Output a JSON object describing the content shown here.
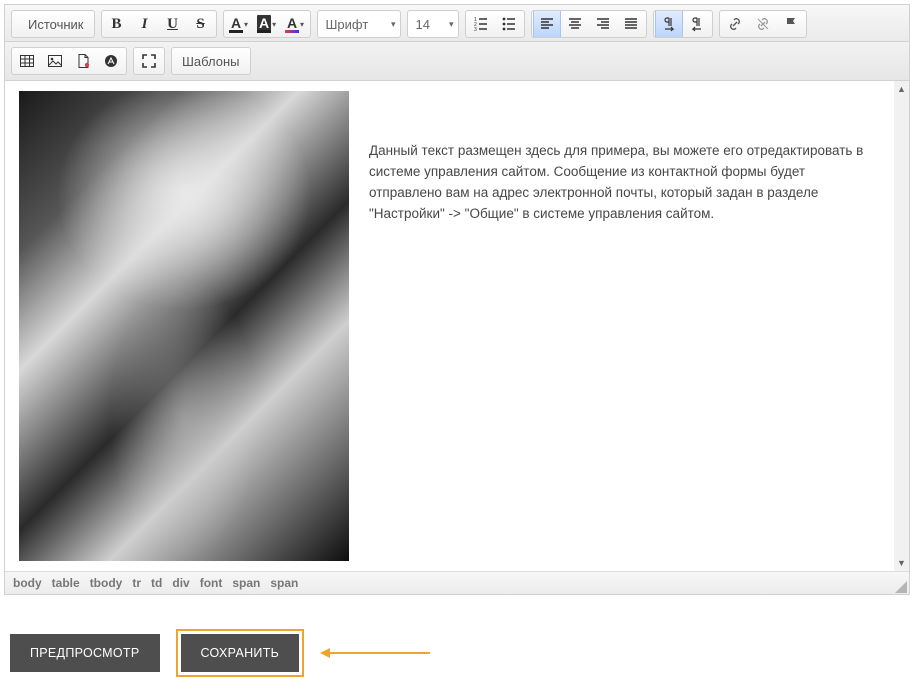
{
  "toolbar": {
    "source_label": "Источник",
    "font_combo": "Шрифт",
    "size_combo": "14",
    "templates_label": "Шаблоны"
  },
  "content": {
    "paragraph": "Данный текст размещен здесь для примера, вы можете его отредактировать в системе управления сайтом. Сообщение из контактной формы будет отправлено вам на адрес электронной почты, который задан в разделе \"Настройки\" -> \"Общие\" в системе управления сайтом."
  },
  "path": {
    "items": [
      "body",
      "table",
      "tbody",
      "tr",
      "td",
      "div",
      "font",
      "span",
      "span"
    ]
  },
  "actions": {
    "preview": "ПРЕДПРОСМОТР",
    "save": "СОХРАНИТЬ"
  }
}
